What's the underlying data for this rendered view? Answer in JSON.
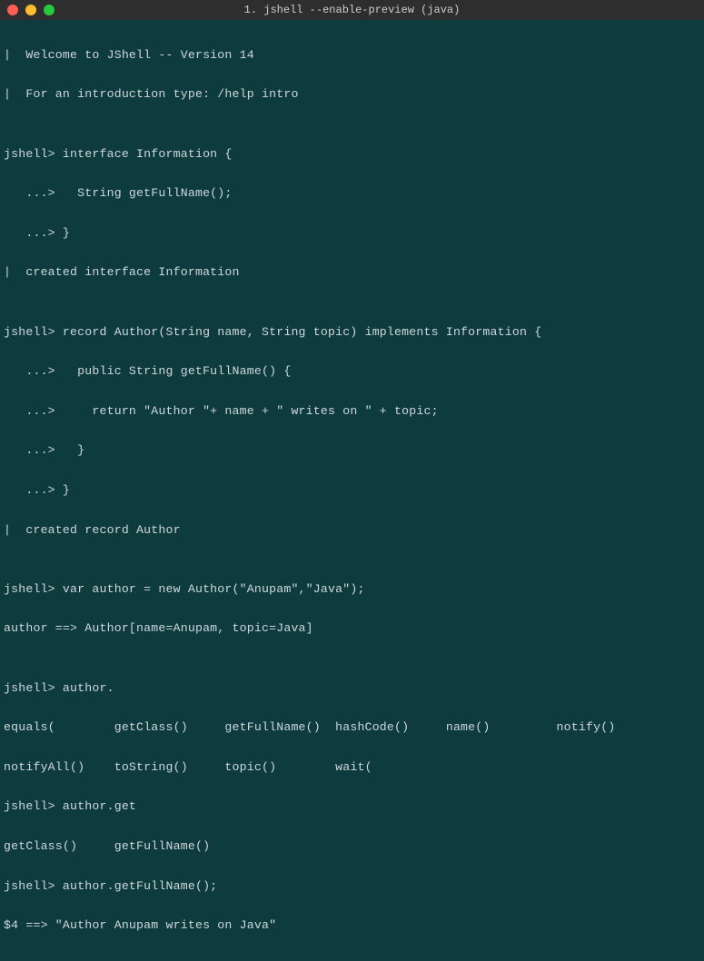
{
  "window": {
    "title": "1. jshell --enable-preview (java)"
  },
  "lines": {
    "welcome1": "|  Welcome to JShell -- Version 14",
    "welcome2": "|  For an introduction type: /help intro",
    "blank": "",
    "l1": "jshell> interface Information {",
    "l2": "   ...>   String getFullName();",
    "l3": "   ...> }",
    "l4": "|  created interface Information",
    "l5": "jshell> record Author(String name, String topic) implements Information {",
    "l6": "   ...>   public String getFullName() {",
    "l7": "   ...>     return \"Author \"+ name + \" writes on \" + topic;",
    "l8": "   ...>   }",
    "l9": "   ...> }",
    "l10": "|  created record Author",
    "l11": "jshell> var author = new Author(\"Anupam\",\"Java\");",
    "l12": "author ==> Author[name=Anupam, topic=Java]",
    "l13": "jshell> author.",
    "l14": "equals(        getClass()     getFullName()  hashCode()     name()         notify()",
    "l15": "notifyAll()    toString()     topic()        wait(",
    "l16": "jshell> author.get",
    "l17": "getClass()     getFullName()",
    "l18": "jshell> author.getFullName();",
    "l19": "$4 ==> \"Author Anupam writes on Java\""
  }
}
